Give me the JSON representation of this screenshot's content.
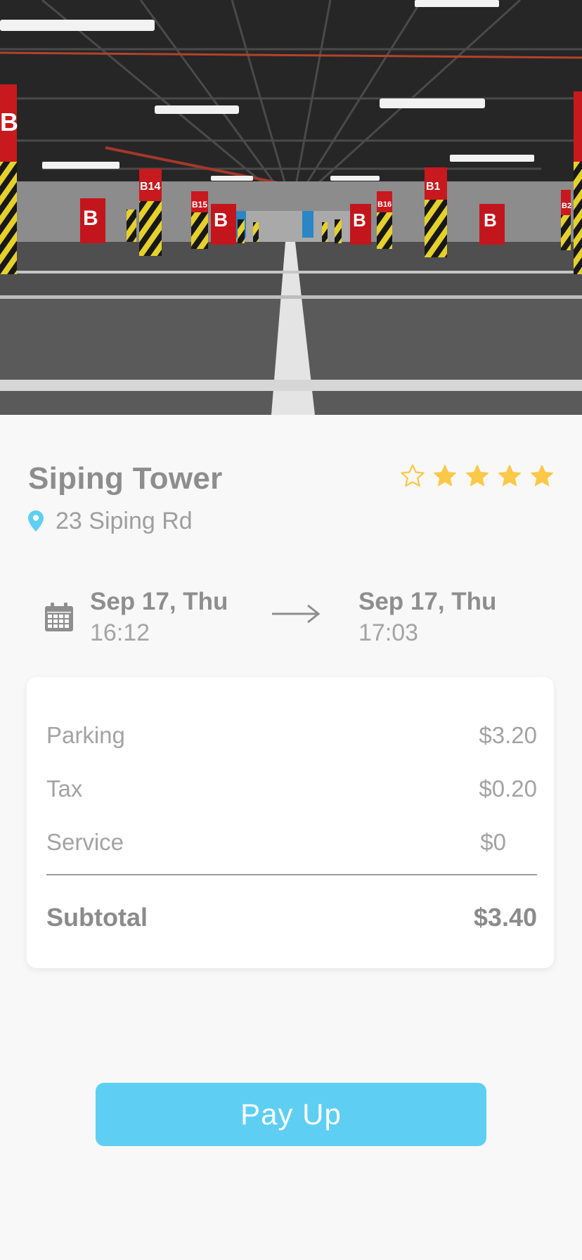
{
  "hero": {
    "icon": "parking-garage-photo",
    "pillar_labels": [
      "B",
      "B14",
      "B",
      "B15",
      "B",
      "B",
      "B16",
      "B1",
      "B",
      "B2"
    ]
  },
  "lot": {
    "name": "Siping Tower",
    "address": "23 Siping Rd",
    "rating": {
      "filled": 4,
      "max": 5
    },
    "icons": {
      "pin": "location-pin-icon",
      "star": "star-icon"
    }
  },
  "time_range": {
    "start_date": "Sep 17, Thu",
    "start_time": "16:12",
    "end_date": "Sep 17, Thu",
    "end_time": "17:03",
    "icons": {
      "calendar": "calendar-icon",
      "arrow": "arrow-right-icon"
    }
  },
  "fees": {
    "items": [
      {
        "label": "Parking",
        "value": "$3.20"
      },
      {
        "label": "Tax",
        "value": "$0.20"
      },
      {
        "label": "Service",
        "value": "$0"
      }
    ],
    "subtotal_label": "Subtotal",
    "subtotal_value": "$3.40"
  },
  "action": {
    "pay_label": "Pay Up"
  },
  "colors": {
    "accent": "#5ecff3",
    "star": "#fcc847",
    "pin": "#5ecff3",
    "text_primary": "#8d8d8d",
    "text_secondary": "#a3a3a3",
    "background": "#f8f8f8"
  }
}
